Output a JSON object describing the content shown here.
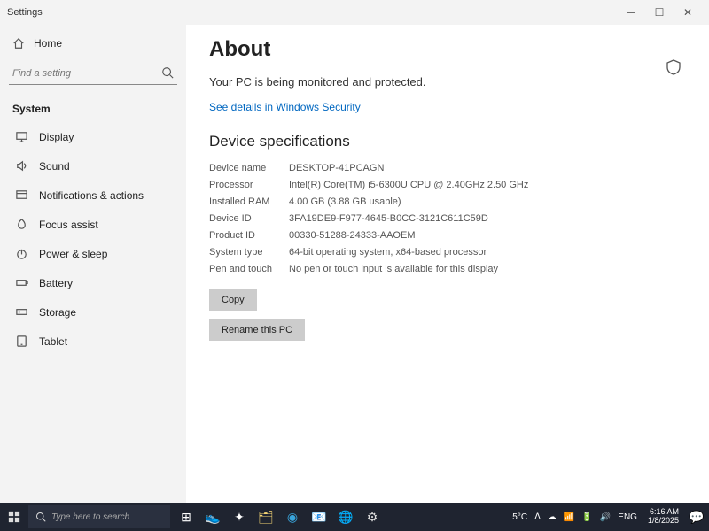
{
  "window": {
    "title": "Settings"
  },
  "sidebar": {
    "home": "Home",
    "search_placeholder": "Find a setting",
    "category": "System",
    "items": [
      {
        "label": "Display"
      },
      {
        "label": "Sound"
      },
      {
        "label": "Notifications & actions"
      },
      {
        "label": "Focus assist"
      },
      {
        "label": "Power & sleep"
      },
      {
        "label": "Battery"
      },
      {
        "label": "Storage"
      },
      {
        "label": "Tablet"
      }
    ]
  },
  "main": {
    "title": "About",
    "protected_text": "Your PC is being monitored and protected.",
    "security_link": "See details in Windows Security",
    "specs_heading": "Device specifications",
    "specs": [
      {
        "label": "Device name",
        "value": "DESKTOP-41PCAGN"
      },
      {
        "label": "Processor",
        "value": "Intel(R) Core(TM) i5-6300U CPU @ 2.40GHz   2.50 GHz"
      },
      {
        "label": "Installed RAM",
        "value": "4.00 GB (3.88 GB usable)"
      },
      {
        "label": "Device ID",
        "value": "3FA19DE9-F977-4645-B0CC-3121C611C59D"
      },
      {
        "label": "Product ID",
        "value": "00330-51288-24333-AAOEM"
      },
      {
        "label": "System type",
        "value": "64-bit operating system, x64-based processor"
      },
      {
        "label": "Pen and touch",
        "value": "No pen or touch input is available for this display"
      }
    ],
    "copy_btn": "Copy",
    "rename_btn": "Rename this PC"
  },
  "taskbar": {
    "search_placeholder": "Type here to search",
    "weather_temp": "5°C",
    "lang": "ENG",
    "time": "6:16 AM",
    "date": "1/8/2025"
  }
}
